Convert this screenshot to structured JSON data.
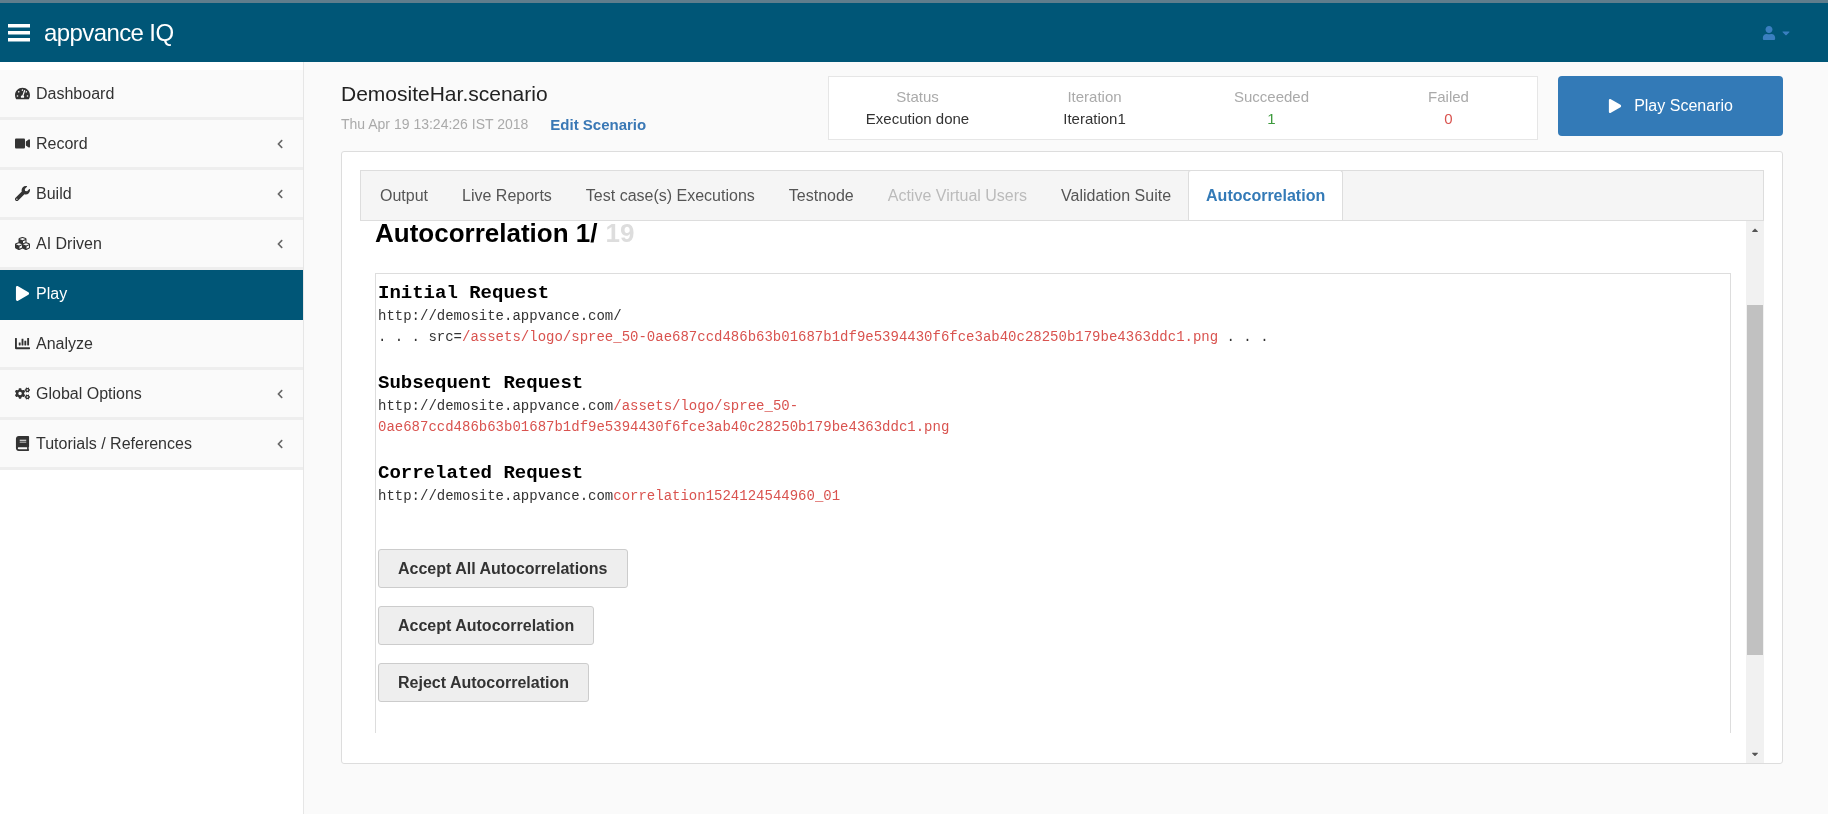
{
  "topbar": {
    "logo": "appvance IQ"
  },
  "sidebar": {
    "items": [
      {
        "label": "Dashboard",
        "selected": false,
        "has_submenu": false
      },
      {
        "label": "Record",
        "selected": false,
        "has_submenu": true
      },
      {
        "label": "Build",
        "selected": false,
        "has_submenu": true
      },
      {
        "label": "AI Driven",
        "selected": false,
        "has_submenu": true
      },
      {
        "label": "Play",
        "selected": true,
        "has_submenu": false
      },
      {
        "label": "Analyze",
        "selected": false,
        "has_submenu": false
      },
      {
        "label": "Global Options",
        "selected": false,
        "has_submenu": true
      },
      {
        "label": "Tutorials / References",
        "selected": false,
        "has_submenu": true
      }
    ]
  },
  "scenario": {
    "title": "DemositeHar.scenario",
    "date": "Thu Apr 19 13:24:26 IST 2018",
    "edit_link": "Edit Scenario"
  },
  "status_card": [
    {
      "label": "Status",
      "value": "Execution done",
      "kind": "plain"
    },
    {
      "label": "Iteration",
      "value": "Iteration1",
      "kind": "plain"
    },
    {
      "label": "Succeeded",
      "value": "1",
      "kind": "success"
    },
    {
      "label": "Failed",
      "value": "0",
      "kind": "failure"
    }
  ],
  "play_button": "Play Scenario",
  "tabs": [
    {
      "label": "Output",
      "selected": false,
      "disabled": false
    },
    {
      "label": "Live Reports",
      "selected": false,
      "disabled": false
    },
    {
      "label": "Test case(s) Executions",
      "selected": false,
      "disabled": false
    },
    {
      "label": "Testnode",
      "selected": false,
      "disabled": false
    },
    {
      "label": "Active Virtual Users",
      "selected": false,
      "disabled": true
    },
    {
      "label": "Validation Suite",
      "selected": false,
      "disabled": false
    },
    {
      "label": "Autocorrelation",
      "selected": true,
      "disabled": false
    }
  ],
  "autocorrelation": {
    "heading": "Autocorrelation 1/",
    "total": "19",
    "sections": [
      {
        "title": "Initial Request",
        "lines": [
          [
            {
              "text": "http://demosite.appvance.com/",
              "highlight": false
            }
          ],
          [
            {
              "text": ". . . src=",
              "highlight": false
            },
            {
              "text": "/assets/logo/spree_50-0ae687ccd486b63b01687b1df9e5394430f6fce3ab40c28250b179be4363ddc1.png",
              "highlight": true
            },
            {
              "text": " . . .",
              "highlight": false
            }
          ]
        ]
      },
      {
        "title": "Subsequent Request",
        "lines": [
          [
            {
              "text": "http://demosite.appvance.com",
              "highlight": false
            },
            {
              "text": "/assets/logo/spree_50-",
              "highlight": true
            }
          ],
          [
            {
              "text": "0ae687ccd486b63b01687b1df9e5394430f6fce3ab40c28250b179be4363ddc1.png",
              "highlight": true
            }
          ]
        ]
      },
      {
        "title": "Correlated Request",
        "lines": [
          [
            {
              "text": "http://demosite.appvance.com",
              "highlight": false
            },
            {
              "text": "correlation1524124544960_01",
              "highlight": true
            }
          ]
        ]
      }
    ],
    "buttons": [
      "Accept All Autocorrelations",
      "Accept Autocorrelation",
      "Reject Autocorrelation"
    ]
  }
}
